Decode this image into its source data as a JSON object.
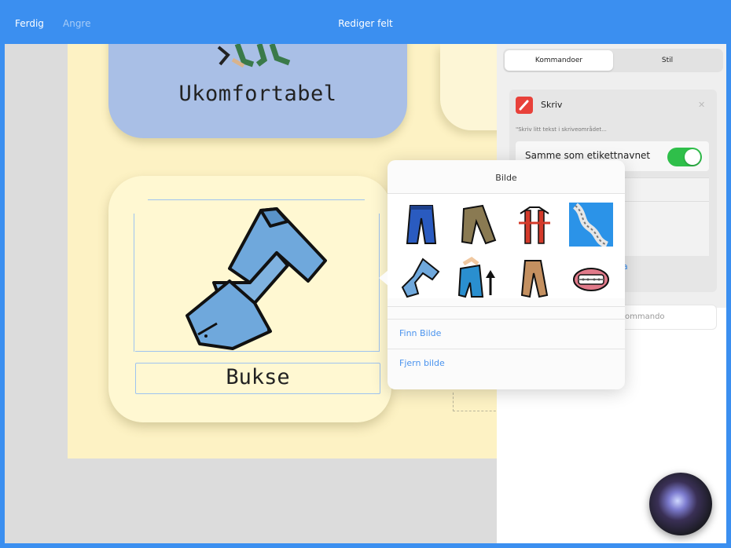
{
  "topbar": {
    "done": "Ferdig",
    "undo": "Angre",
    "title": "Rediger felt"
  },
  "board": {
    "cells": [
      {
        "label": "Ukomfortabel"
      },
      {
        "label": "Bukse"
      }
    ]
  },
  "panel": {
    "tabs": [
      {
        "label": "Kommandoer"
      },
      {
        "label": "Stil"
      }
    ],
    "command": {
      "title": "Skriv",
      "description": "\"Skriv litt tekst i skriveområdet...",
      "toggle_label": "Samme som etikettnavnet",
      "toggle_on": true,
      "partial_link": "a"
    },
    "add_command_placeholder": "ommando"
  },
  "popover": {
    "title": "Bilde",
    "thumbnails": [
      {
        "icon": "blue-jeans-icon"
      },
      {
        "icon": "brown-pants-icon"
      },
      {
        "icon": "red-suspenders-icon"
      },
      {
        "icon": "rope-icon"
      },
      {
        "icon": "folded-jeans-icon"
      },
      {
        "icon": "pull-up-pants-icon"
      },
      {
        "icon": "tan-pants-icon"
      },
      {
        "icon": "braces-mouth-icon"
      }
    ],
    "find_image": "Finn Bilde",
    "remove_image": "Fjern bilde"
  },
  "colors": {
    "accent": "#3b8ff0",
    "board_bg": "#fdf2c4",
    "toggle_on": "#2fbf4a",
    "command_icon": "#e8413a"
  }
}
